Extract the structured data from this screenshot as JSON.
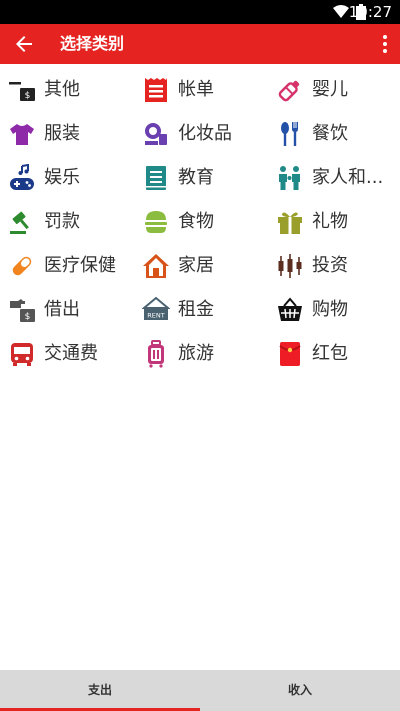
{
  "status": {
    "time": "10:27"
  },
  "appbar": {
    "title": "选择类别"
  },
  "categories": [
    {
      "label": "其他"
    },
    {
      "label": "帐单"
    },
    {
      "label": "婴儿"
    },
    {
      "label": "服装"
    },
    {
      "label": "化妆品"
    },
    {
      "label": "餐饮"
    },
    {
      "label": "娱乐"
    },
    {
      "label": "教育"
    },
    {
      "label": "家人和..."
    },
    {
      "label": "罚款"
    },
    {
      "label": "食物"
    },
    {
      "label": "礼物"
    },
    {
      "label": "医疗保健"
    },
    {
      "label": "家居"
    },
    {
      "label": "投资"
    },
    {
      "label": "借出"
    },
    {
      "label": "租金"
    },
    {
      "label": "购物"
    },
    {
      "label": "交通费"
    },
    {
      "label": "旅游"
    },
    {
      "label": "红包"
    }
  ],
  "tabs": {
    "expense": "支出",
    "income": "收入"
  },
  "colors": {
    "accent": "#e52422",
    "tabbar": "#d9d9d9"
  },
  "icons": [
    "other-icon",
    "bill-icon",
    "baby-bottle-icon",
    "clothing-icon",
    "cosmetics-icon",
    "dining-icon",
    "entertainment-icon",
    "education-icon",
    "family-icon",
    "fine-icon",
    "food-icon",
    "gift-icon",
    "healthcare-icon",
    "home-icon",
    "investment-icon",
    "lend-icon",
    "rent-icon",
    "shopping-icon",
    "transport-icon",
    "travel-icon",
    "red-envelope-icon"
  ]
}
